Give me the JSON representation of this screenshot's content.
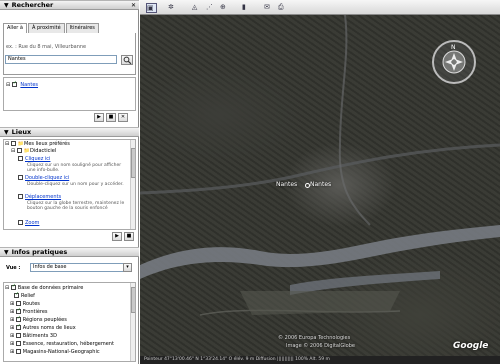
{
  "search_panel": {
    "title": "Rechercher",
    "tabs": [
      "Aller à",
      "À proximité",
      "Itinéraires"
    ],
    "example_hint": "ex. : Rue du 8 mai, Villeurbanne",
    "search_value": "Nantes",
    "result": "Nantes"
  },
  "places_panel": {
    "title": "Lieux",
    "root": "Mes lieux préférés",
    "folder": "Didacticiel",
    "items": [
      {
        "label": "Cliquez ici",
        "desc": "Cliquez sur un nom souligné pour afficher une info-bulle."
      },
      {
        "label": "Double-cliquez ici",
        "desc": "Double-cliquez sur un nom pour y accéder."
      },
      {
        "label": "Déplacements",
        "desc": "Cliquez sur la globe terrestre, maintenez le bouton gauche de la souris enfoncé"
      },
      {
        "label": "Zoom",
        "desc": ""
      }
    ]
  },
  "layers_panel": {
    "title": "Infos pratiques",
    "view_label": "Vue :",
    "view_value": "Infos de base",
    "items": [
      "Base de données primaire",
      "Relief",
      "Routes",
      "Frontières",
      "Régions peuplées",
      "Autres noms de lieux",
      "Bâtiments 3D",
      "Essence, restauration, hébergement",
      "Magasins-National-Geographic"
    ]
  },
  "map": {
    "labels": [
      "Nantes",
      "Nantes"
    ],
    "copyright1": "© 2006 Europa Technologies",
    "copyright2": "Image © 2006 DigitalGlobe",
    "status": "Pointeur 47°13'00.46\" N  1°33'24.14\" O  élév. 9 m     Diffusion ||||||||||| 100%     Alt. 59 m",
    "logo": "Google"
  },
  "colors": {
    "accent": "#0033cc",
    "map_bg": "#33342f",
    "river": "#7a7f86"
  }
}
